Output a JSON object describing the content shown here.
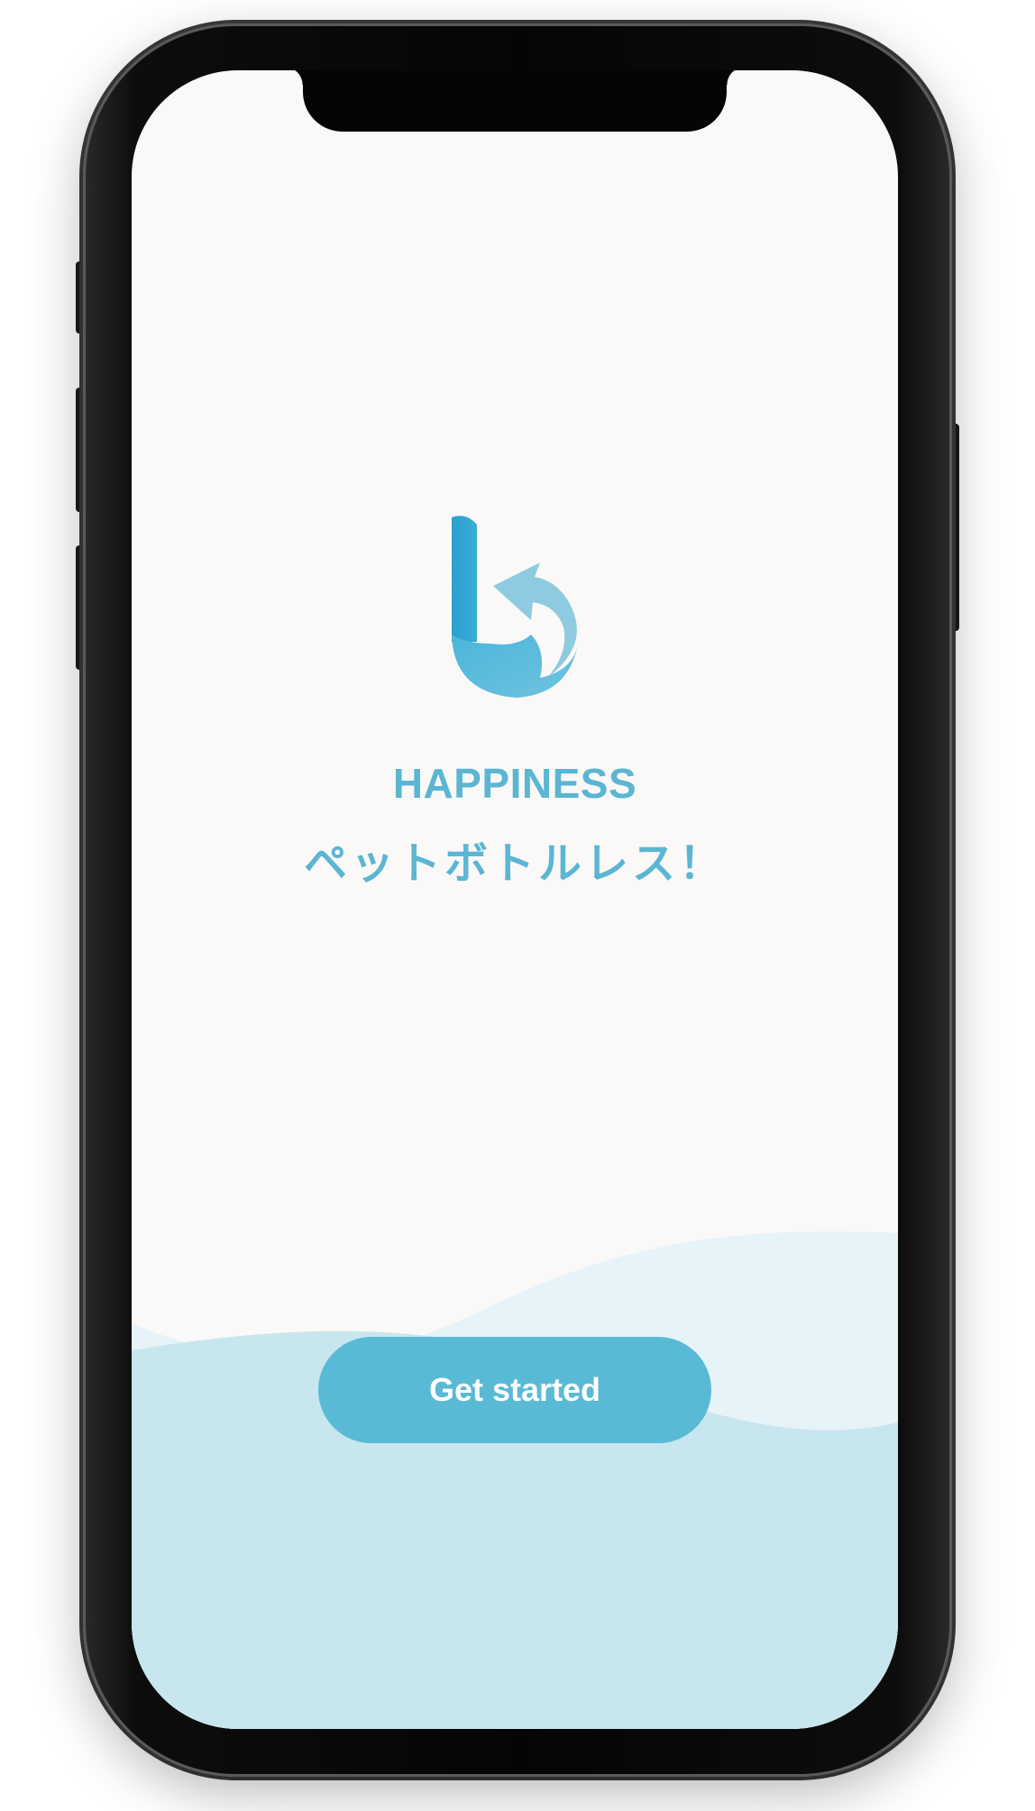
{
  "app": {
    "name": "HAPPINESS",
    "tagline": "ペットボトルレス！",
    "logo_icon": "recycle-b-logo-icon"
  },
  "onboarding": {
    "cta_label": "Get started"
  },
  "colors": {
    "accent": "#59bad5",
    "text_brand": "#5bb6d3",
    "background": "#faf9f8",
    "wave_light": "#e6f3f8",
    "wave_main": "#c8e6ee"
  }
}
